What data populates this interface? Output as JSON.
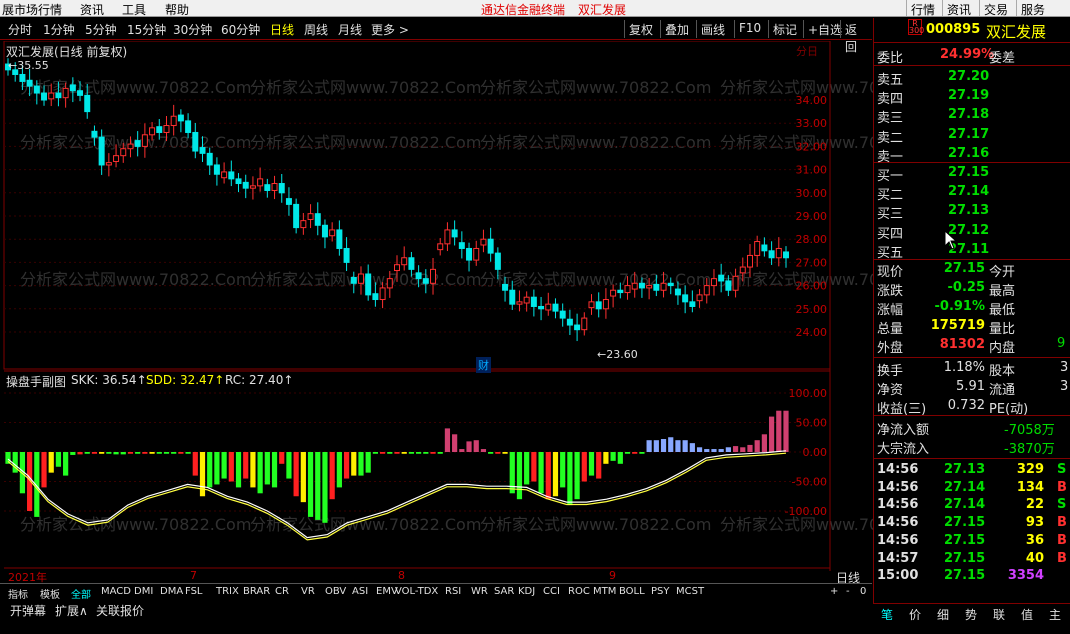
{
  "menu": {
    "items": [
      "展市场行情",
      "资讯",
      "工具",
      "帮助"
    ],
    "center": "通达信金融终端",
    "stock_title": "双汇发展",
    "right": [
      "行情",
      "资讯",
      "交易",
      "服务"
    ]
  },
  "periods": [
    "分时",
    "1分钟",
    "5分钟",
    "15分钟",
    "30分钟",
    "60分钟",
    "日线",
    "周线",
    "月线",
    "更多 >"
  ],
  "active_period": "日线",
  "toolbar": [
    "复权",
    "叠加",
    "画线",
    "F10",
    "标记",
    "+自选",
    "返回"
  ],
  "chart_title": "双汇发展(日线 前复权)",
  "price_high_label": "35.55",
  "price_low_label": "23.60",
  "cai_label": "财",
  "watermark": "分析家公式网www.70822.Com",
  "price_axis": [
    "34.00",
    "33.00",
    "32.00",
    "31.00",
    "30.00",
    "29.00",
    "28.00",
    "27.00",
    "26.00",
    "25.00",
    "24.00"
  ],
  "ind_axis": [
    "100.00",
    "50.00",
    "0.00",
    "-50.00",
    "-100.00"
  ],
  "indicator": {
    "name": "操盘手副图",
    "skk_label": "SKK: 36.54↑",
    "sdd_label": "SDD: 32.47↑",
    "rc_label": "RC: 27.40↑"
  },
  "date_labels": [
    "2021年",
    "7",
    "8",
    "9"
  ],
  "period_box": "日线",
  "zoom": [
    "+",
    "-",
    "0"
  ],
  "indicator_tabs": [
    "指标",
    "模板",
    "全部",
    "MACD",
    "DMI",
    "DMA",
    "FSL",
    "TRIX",
    "BRAR",
    "CR",
    "VR",
    "OBV",
    "ASI",
    "EMV",
    "VOL-TDX",
    "RSI",
    "WR",
    "SAR",
    "KDJ",
    "CCI",
    "ROC",
    "MTM",
    "BOLL",
    "PSY",
    "MCST"
  ],
  "bottom2": [
    "开弹幕",
    "扩展∧",
    "关联报价"
  ],
  "quote": {
    "badge_top": "R",
    "badge_bot": "300",
    "code": "000895",
    "name": "双汇发展",
    "weibi_label": "委比",
    "weibi": "24.99%",
    "weicha_label": "委差",
    "asks": [
      {
        "l": "卖五",
        "p": "27.20"
      },
      {
        "l": "卖四",
        "p": "27.19"
      },
      {
        "l": "卖三",
        "p": "27.18"
      },
      {
        "l": "卖二",
        "p": "27.17"
      },
      {
        "l": "卖一",
        "p": "27.16"
      }
    ],
    "bids": [
      {
        "l": "买一",
        "p": "27.15"
      },
      {
        "l": "买二",
        "p": "27.14"
      },
      {
        "l": "买三",
        "p": "27.13"
      },
      {
        "l": "买四",
        "p": "27.12"
      },
      {
        "l": "买五",
        "p": "27.11"
      }
    ],
    "stats": [
      {
        "l": "现价",
        "v": "27.15",
        "l2": "今开",
        "c": "#00dd00"
      },
      {
        "l": "涨跌",
        "v": "-0.25",
        "l2": "最高",
        "c": "#00dd00"
      },
      {
        "l": "涨幅",
        "v": "-0.91%",
        "l2": "最低",
        "c": "#00dd00"
      },
      {
        "l": "总量",
        "v": "175719",
        "l2": "量比",
        "c": "#ffff00"
      },
      {
        "l": "外盘",
        "v": "81302",
        "l2": "内盘",
        "c": "#ff3030"
      }
    ],
    "neipan_digit": "9",
    "fund": [
      {
        "l": "换手",
        "v": "1.18%",
        "l2": "股本",
        "d": "3"
      },
      {
        "l": "净资",
        "v": "5.91",
        "l2": "流通",
        "d": "3"
      },
      {
        "l": "收益(三)",
        "v": "0.732",
        "l2": "PE(动)",
        "d": ""
      }
    ],
    "netflow_label": "净流入额",
    "netflow": "-7058万",
    "bigflow_label": "大宗流入",
    "bigflow": "-3870万",
    "ticks": [
      {
        "t": "14:56",
        "p": "27.13",
        "v": "329",
        "vc": "#ffff00",
        "s": "S"
      },
      {
        "t": "14:56",
        "p": "27.14",
        "v": "134",
        "vc": "#ffff00",
        "s": "B"
      },
      {
        "t": "14:56",
        "p": "27.14",
        "v": "22",
        "vc": "#ffff00",
        "s": "S"
      },
      {
        "t": "14:56",
        "p": "27.15",
        "v": "93",
        "vc": "#ffff00",
        "s": "B"
      },
      {
        "t": "14:56",
        "p": "27.15",
        "v": "36",
        "vc": "#ffff00",
        "s": "B"
      },
      {
        "t": "14:57",
        "p": "27.15",
        "v": "40",
        "vc": "#ffff00",
        "s": "B"
      },
      {
        "t": "15:00",
        "p": "27.15",
        "v": "3354",
        "vc": "#d040ff",
        "s": ""
      }
    ],
    "tabs": [
      "笔",
      "价",
      "细",
      "势",
      "联",
      "值",
      "主"
    ]
  }
}
